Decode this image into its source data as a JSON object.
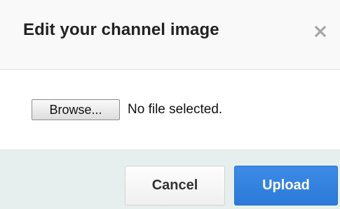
{
  "dialog": {
    "title": "Edit your channel image",
    "close_icon": "close-x-icon"
  },
  "file_input": {
    "browse_label": "Browse...",
    "status_text": "No file selected."
  },
  "footer": {
    "cancel_label": "Cancel",
    "upload_label": "Upload"
  },
  "colors": {
    "upload_button": "#2c7ad9",
    "footer_background": "#e6efee",
    "header_background": "#f9f9f9"
  }
}
